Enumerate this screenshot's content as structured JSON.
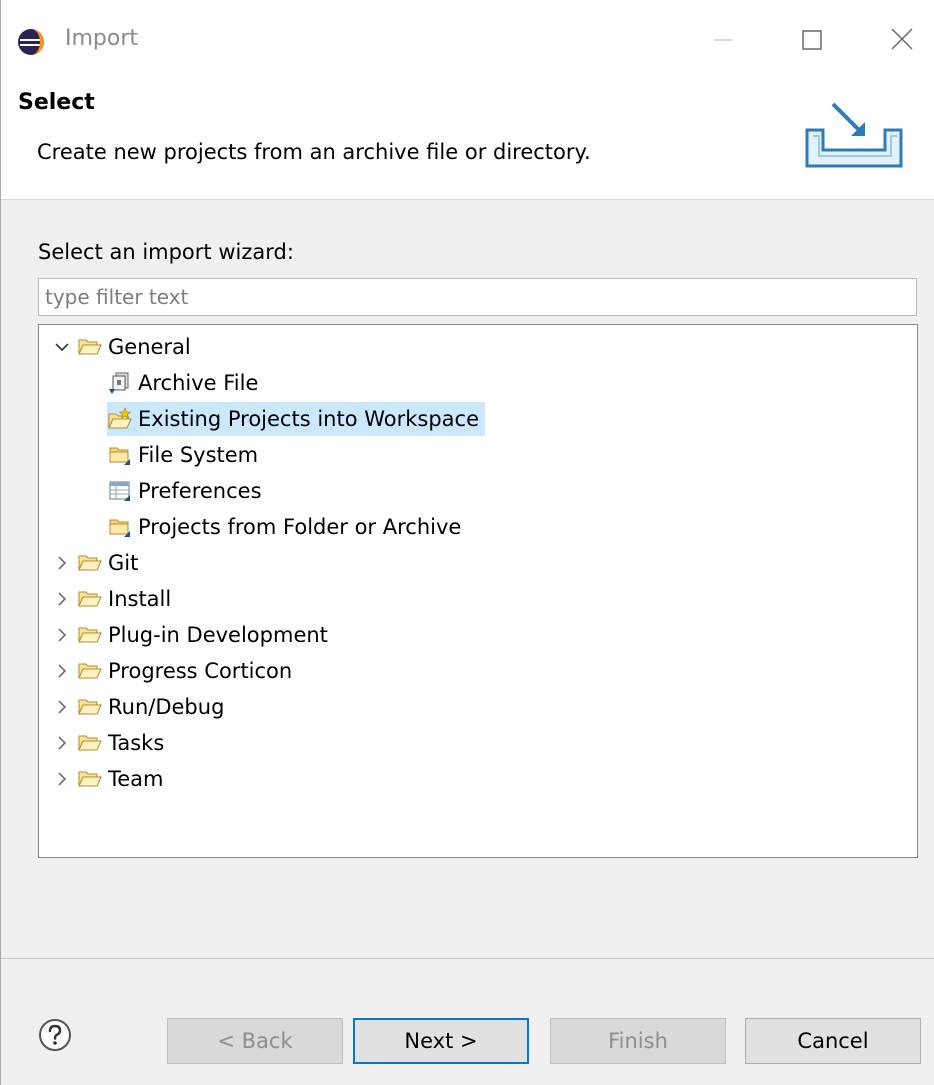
{
  "window": {
    "title": "Import",
    "app_icon": "eclipse-icon",
    "controls": [
      "minimize-icon",
      "maximize-icon",
      "close-icon"
    ]
  },
  "banner": {
    "title": "Select",
    "description": "Create new projects from an archive file or directory.",
    "icon": "import-tray-icon"
  },
  "wizard": {
    "label": "Select an import wizard:",
    "filter_placeholder": "type filter text",
    "filter_value": "",
    "selection_color": "#cce8ff",
    "tree": [
      {
        "label": "General",
        "expanded": true,
        "icon": "folder-open-icon",
        "level": 0
      },
      {
        "label": "Archive File",
        "icon": "archive-file-icon",
        "level": 1
      },
      {
        "label": "Existing Projects into Workspace",
        "icon": "new-project-folder-icon",
        "level": 1,
        "selected": true
      },
      {
        "label": "File System",
        "icon": "folder-import-icon",
        "level": 1
      },
      {
        "label": "Preferences",
        "icon": "preferences-icon",
        "level": 1
      },
      {
        "label": "Projects from Folder or Archive",
        "icon": "folder-import-icon",
        "level": 1
      },
      {
        "label": "Git",
        "expanded": false,
        "icon": "folder-open-icon",
        "level": 0
      },
      {
        "label": "Install",
        "expanded": false,
        "icon": "folder-open-icon",
        "level": 0
      },
      {
        "label": "Plug-in Development",
        "expanded": false,
        "icon": "folder-open-icon",
        "level": 0
      },
      {
        "label": "Progress Corticon",
        "expanded": false,
        "icon": "folder-open-icon",
        "level": 0
      },
      {
        "label": "Run/Debug",
        "expanded": false,
        "icon": "folder-open-icon",
        "level": 0
      },
      {
        "label": "Tasks",
        "expanded": false,
        "icon": "folder-open-icon",
        "level": 0
      },
      {
        "label": "Team",
        "expanded": false,
        "icon": "folder-open-icon",
        "level": 0
      }
    ]
  },
  "footer": {
    "help_icon": "help-icon",
    "back_label": "< Back",
    "next_label": "Next >",
    "finish_label": "Finish",
    "cancel_label": "Cancel",
    "back_enabled": false,
    "finish_enabled": false
  }
}
